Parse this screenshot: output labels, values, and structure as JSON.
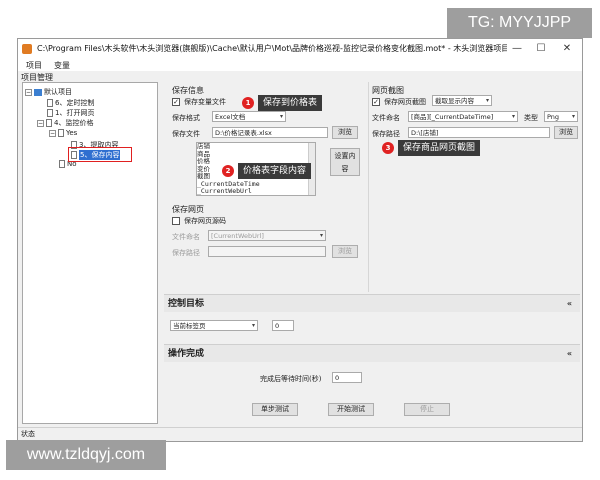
{
  "watermark": {
    "top": "TG: MYYJJPP",
    "bottom": "www.tzldqyj.com"
  },
  "window": {
    "title": "C:\\Program Files\\木头软件\\木头浏览器(旗舰版)\\Cache\\默认用户\\Mot\\品牌价格巡视-监控记录价格变化截图.mot* - 木头浏览器项目管理(...",
    "min_glyph": "—",
    "max_glyph": "☐",
    "close_glyph": "✕"
  },
  "menu": {
    "items": [
      "项目",
      "变量"
    ]
  },
  "tree": {
    "label": "项目管理",
    "nodes": [
      {
        "text": "默认项目",
        "expander": "−"
      },
      {
        "text": "6、定时控制"
      },
      {
        "text": "1、打开网页"
      },
      {
        "text": "4、监控价格",
        "expander": "−"
      },
      {
        "text": "Yes",
        "expander": "−"
      },
      {
        "text": "3、提取内容"
      },
      {
        "text": "5、保存内容"
      },
      {
        "text": "No"
      }
    ]
  },
  "save_info": {
    "title": "保存信息",
    "save_vars_label": "保存变量文件",
    "format_label": "保存格式",
    "format_value": "Excel文档",
    "file_label": "保存文件",
    "file_value": "D:\\价格记录表.xlsx",
    "browse": "浏览",
    "fields_list": [
      "店铺",
      "商品",
      "价格",
      "变价",
      "截图",
      "_CurrentDateTime",
      "_CurrentWebUrl"
    ],
    "set_content_button": "设置内容",
    "callout1_num": "1",
    "callout1_text": "保存到价格表",
    "callout2_num": "2",
    "callout2_text": "价格表字段内容"
  },
  "save_page": {
    "title": "保存网页",
    "save_source_label": "保存网页源码",
    "name_label": "文件命名",
    "name_value": "[CurrentWebUrl]",
    "path_label": "保存路径",
    "browse": "浏览"
  },
  "screenshot": {
    "title": "网页截图",
    "save_label": "保存网页截图",
    "mode_value": "截取显示内容",
    "name_label": "文件命名",
    "name_value": "[商品][_CurrentDateTime]",
    "type_label": "类型",
    "type_value": "Png",
    "path_label": "保存路径",
    "path_value": "D:\\[店铺]",
    "browse": "浏览",
    "callout3_num": "3",
    "callout3_text": "保存商品网页截图"
  },
  "control_target": {
    "title": "控制目标",
    "tab_value": "当前标签页",
    "index_value": "0",
    "collapse": "«"
  },
  "done": {
    "title": "操作完成",
    "wait_label": "完成后等待时间(秒)",
    "wait_value": "0",
    "collapse": "«"
  },
  "actions": {
    "step": "单步测试",
    "start": "开始测试",
    "stop": "停止"
  },
  "status": {
    "text": "状态"
  }
}
